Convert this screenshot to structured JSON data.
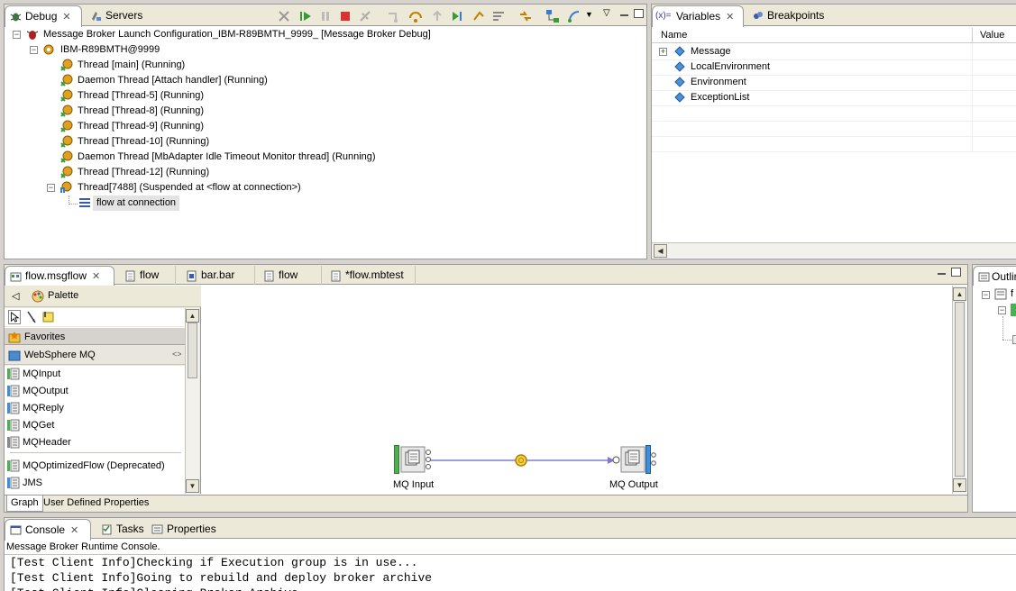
{
  "debug_view": {
    "tab_debug": "Debug",
    "tab_servers": "Servers",
    "tree": {
      "launch": "Message Broker Launch Configuration_IBM-R89BMTH_9999_ [Message Broker Debug]",
      "target": "IBM-R89BMTH@9999",
      "threads": [
        "Thread [main] (Running)",
        "Daemon Thread [Attach handler] (Running)",
        "Thread [Thread-5] (Running)",
        "Thread [Thread-8] (Running)",
        "Thread [Thread-9] (Running)",
        "Thread [Thread-10] (Running)",
        "Daemon Thread [MbAdapter Idle Timeout Monitor thread] (Running)",
        "Thread [Thread-12] (Running)"
      ],
      "suspended_thread": "Thread[7488] (Suspended at <flow at connection>)",
      "stack_frame": "flow at connection"
    }
  },
  "variables_view": {
    "tab_variables": "Variables",
    "tab_breakpoints": "Breakpoints",
    "col_name": "Name",
    "col_value": "Value",
    "rows": [
      "Message",
      "LocalEnvironment",
      "Environment",
      "ExceptionList"
    ]
  },
  "editor": {
    "tabs": [
      "flow.msgflow",
      "flow",
      "bar.bar",
      "flow",
      "*flow.mbtest"
    ],
    "palette_title": "Palette",
    "drawers": {
      "favorites": "Favorites",
      "websphere_mq": "WebSphere MQ"
    },
    "palette_items": [
      "MQInput",
      "MQOutput",
      "MQReply",
      "MQGet",
      "MQHeader",
      "MQOptimizedFlow (Deprecated)",
      "JMS"
    ],
    "nodes": {
      "input_label": "MQ Input",
      "output_label": "MQ Output"
    },
    "bottom_tabs": [
      "Graph",
      "User Defined Properties"
    ]
  },
  "outline_view": {
    "tab_label": "Outlin"
  },
  "console_view": {
    "tab_console": "Console",
    "tab_tasks": "Tasks",
    "tab_properties": "Properties",
    "title": "Message Broker Runtime Console.",
    "lines": [
      "[Test Client Info]Checking if Execution group is in use...",
      "[Test Client Info]Going to rebuild and deploy broker archive",
      "[Test Client Info]Cleaning Broker Archive"
    ]
  },
  "colors": {
    "chrome": "#d6d3ce",
    "tabbar": "#ece9d8",
    "node_green": "#4caf50",
    "node_blue": "#3f8fd8",
    "connection": "#7b7bd6",
    "breakpoint": "#e0b000"
  }
}
